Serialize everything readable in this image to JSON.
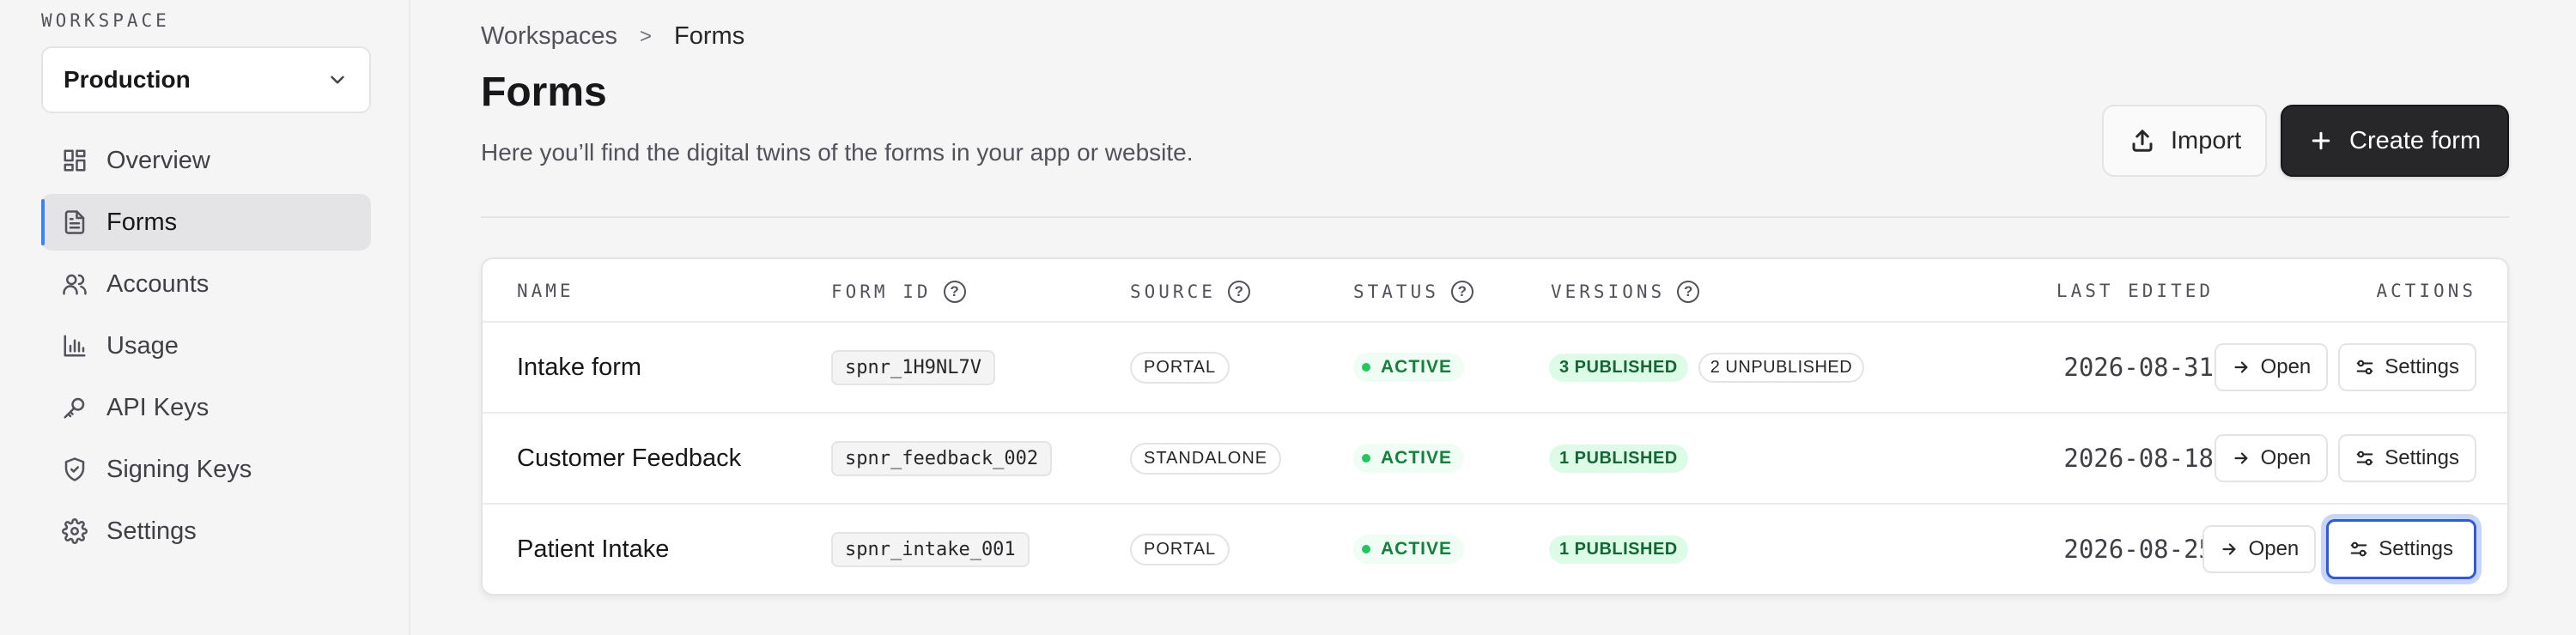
{
  "sidebar": {
    "workspace_label": "WORKSPACE",
    "workspace_value": "Production",
    "items": [
      {
        "label": "Overview",
        "icon": "grid-icon"
      },
      {
        "label": "Forms",
        "icon": "document-icon",
        "active": true
      },
      {
        "label": "Accounts",
        "icon": "users-icon"
      },
      {
        "label": "Usage",
        "icon": "bar-chart-icon"
      },
      {
        "label": "API Keys",
        "icon": "key-icon"
      },
      {
        "label": "Signing Keys",
        "icon": "shield-icon"
      },
      {
        "label": "Settings",
        "icon": "gear-icon"
      }
    ]
  },
  "header": {
    "breadcrumb": [
      "Workspaces",
      "Forms"
    ],
    "title": "Forms",
    "subtitle": "Here you’ll find the digital twins of the forms in your app or website.",
    "import_label": "Import",
    "create_label": "Create form"
  },
  "table": {
    "columns": {
      "name": "NAME",
      "form_id": "FORM ID",
      "source": "SOURCE",
      "status": "STATUS",
      "versions": "VERSIONS",
      "last_edited": "LAST EDITED",
      "actions": "ACTIONS"
    },
    "rows": [
      {
        "name": "Intake form",
        "form_id": "spnr_1H9NL7V",
        "source": "PORTAL",
        "status": "ACTIVE",
        "published": "3 PUBLISHED",
        "unpublished": "2 UNPUBLISHED",
        "last_edited": "2026-08-31",
        "open": "Open",
        "settings": "Settings"
      },
      {
        "name": "Customer Feedback",
        "form_id": "spnr_feedback_002",
        "source": "STANDALONE",
        "status": "ACTIVE",
        "published": "1 PUBLISHED",
        "unpublished": "",
        "last_edited": "2026-08-18",
        "open": "Open",
        "settings": "Settings"
      },
      {
        "name": "Patient Intake",
        "form_id": "spnr_intake_001",
        "source": "PORTAL",
        "status": "ACTIVE",
        "published": "1 PUBLISHED",
        "unpublished": "",
        "last_edited": "2026-08-25",
        "open": "Open",
        "settings": "Settings"
      }
    ]
  },
  "colors": {
    "accent": "#3b82f6",
    "primary_button": "#27272a",
    "status_green": "#22c55e",
    "focus_ring": "#2f5ad8"
  }
}
